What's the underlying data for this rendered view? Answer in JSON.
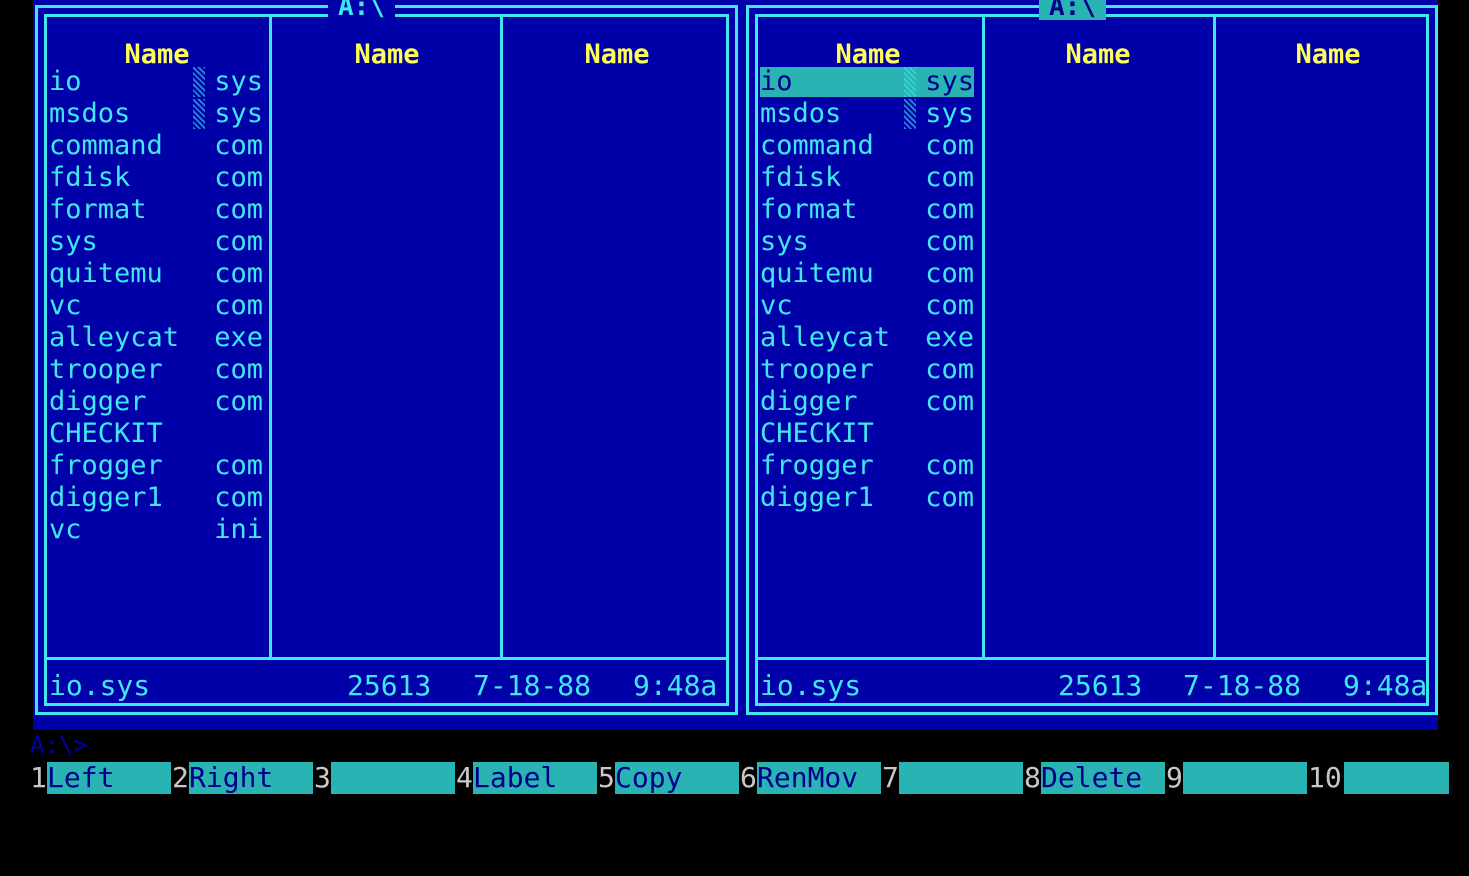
{
  "left_panel": {
    "path": "A:\\",
    "headers": [
      "Name",
      "Name",
      "Name"
    ],
    "files": [
      {
        "name": "io",
        "ext": "sys",
        "hidden": true
      },
      {
        "name": "msdos",
        "ext": "sys",
        "hidden": true
      },
      {
        "name": "command",
        "ext": "com"
      },
      {
        "name": "fdisk",
        "ext": "com"
      },
      {
        "name": "format",
        "ext": "com"
      },
      {
        "name": "sys",
        "ext": "com"
      },
      {
        "name": "quitemu",
        "ext": "com"
      },
      {
        "name": "vc",
        "ext": "com"
      },
      {
        "name": "alleycat",
        "ext": "exe"
      },
      {
        "name": "trooper",
        "ext": "com"
      },
      {
        "name": "digger",
        "ext": "com"
      },
      {
        "name": "CHECKIT",
        "ext": ""
      },
      {
        "name": "frogger",
        "ext": "com"
      },
      {
        "name": "digger1",
        "ext": "com"
      },
      {
        "name": "vc",
        "ext": "ini"
      }
    ],
    "status": {
      "file": "io.sys",
      "size": "25613",
      "date": "7-18-88",
      "time": "9:48a"
    }
  },
  "right_panel": {
    "path": "A:\\",
    "headers": [
      "Name",
      "Name",
      "Name"
    ],
    "files": [
      {
        "name": "io",
        "ext": "sys",
        "hidden": true,
        "selected": true
      },
      {
        "name": "msdos",
        "ext": "sys",
        "hidden": true
      },
      {
        "name": "command",
        "ext": "com"
      },
      {
        "name": "fdisk",
        "ext": "com"
      },
      {
        "name": "format",
        "ext": "com"
      },
      {
        "name": "sys",
        "ext": "com"
      },
      {
        "name": "quitemu",
        "ext": "com"
      },
      {
        "name": "vc",
        "ext": "com"
      },
      {
        "name": "alleycat",
        "ext": "exe"
      },
      {
        "name": "trooper",
        "ext": "com"
      },
      {
        "name": "digger",
        "ext": "com"
      },
      {
        "name": "CHECKIT",
        "ext": ""
      },
      {
        "name": "frogger",
        "ext": "com"
      },
      {
        "name": "digger1",
        "ext": "com"
      }
    ],
    "status": {
      "file": "io.sys",
      "size": "25613",
      "date": "7-18-88",
      "time": "9:48a"
    }
  },
  "command_line": {
    "prompt": "A:\\>"
  },
  "function_keys": [
    {
      "num": "1",
      "label": "Left"
    },
    {
      "num": "2",
      "label": "Right"
    },
    {
      "num": "3",
      "label": ""
    },
    {
      "num": "4",
      "label": "Label"
    },
    {
      "num": "5",
      "label": "Copy"
    },
    {
      "num": "6",
      "label": "RenMov"
    },
    {
      "num": "7",
      "label": ""
    },
    {
      "num": "8",
      "label": "Delete"
    },
    {
      "num": "9",
      "label": ""
    },
    {
      "num": "10",
      "label": ""
    }
  ],
  "colors": {
    "background": "#0000a8",
    "border": "#3fe8f0",
    "header": "#ffff55",
    "highlight": "#2ab3b3"
  }
}
